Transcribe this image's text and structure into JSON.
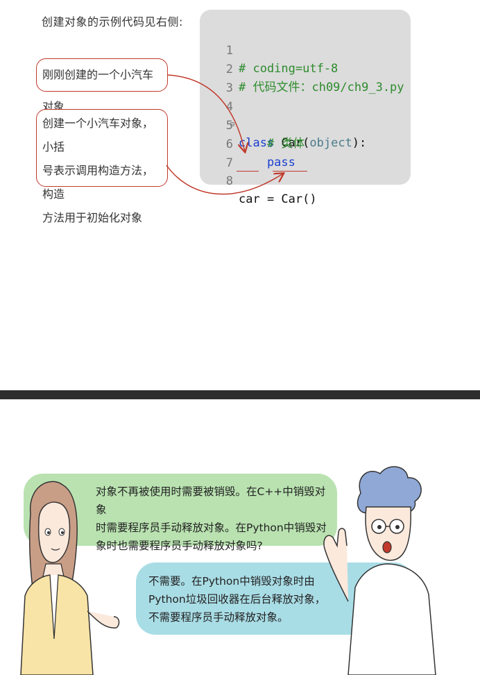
{
  "intro": "创建对象的示例代码见右侧:",
  "notes": {
    "note1": "刚刚创建的一个小汽车对象",
    "note2": [
      "创建一个小汽车对象，小括",
      "号表示调用构造方法，构造",
      "方法用于初始化对象"
    ]
  },
  "code": {
    "lines": [
      {
        "num": "1",
        "text": "# coding=utf-8"
      },
      {
        "num": "2",
        "text": "# 代码文件：ch09/ch9_3.py"
      },
      {
        "num": "3",
        "text": ""
      },
      {
        "num": "4",
        "kw": "class",
        "rest_a": " Car(",
        "builtin": "object",
        "rest_b": "):"
      },
      {
        "num": "5",
        "text": "    # 类体"
      },
      {
        "num": "6",
        "kw": "    pass"
      },
      {
        "num": "7",
        "text": ""
      },
      {
        "num": "8",
        "text": "car = Car()"
      }
    ],
    "fold_marker": "⊟"
  },
  "comic": {
    "question": [
      "对象不再被使用时需要被销毁。在C++中销毁对象",
      "时需要程序员手动释放对象。在Python中销毁对",
      "象时也需要程序员手动释放对象吗?"
    ],
    "answer": [
      "不需要。在Python中销毁对象时由",
      "Python垃圾回收器在后台释放对象，",
      "不需要程序员手动释放对象。"
    ]
  },
  "colors": {
    "code_bg": "#dcdcdc",
    "comment": "#2e8b2e",
    "keyword": "#1a3fcf",
    "annotation": "#c0392b",
    "bubble_green": "#b9e2b0",
    "bubble_blue": "#a9dde6",
    "divider": "#2d2d2d"
  }
}
